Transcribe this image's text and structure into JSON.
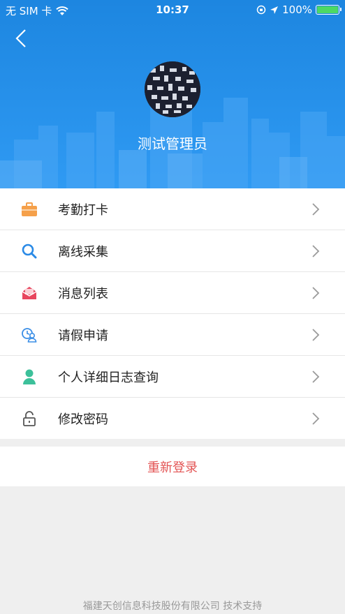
{
  "status_bar": {
    "carrier": "无 SIM 卡",
    "time": "10:37",
    "battery_text": "100%",
    "battery_level": 1.0
  },
  "profile": {
    "name": "测试管理员"
  },
  "menu": {
    "items": [
      {
        "label": "考勤打卡",
        "icon": "briefcase-icon",
        "color": "#f5a04a"
      },
      {
        "label": "离线采集",
        "icon": "search-icon",
        "color": "#2a8ae6"
      },
      {
        "label": "消息列表",
        "icon": "envelope-icon",
        "color": "#e8465e"
      },
      {
        "label": "请假申请",
        "icon": "leave-request-icon",
        "color": "#3a8ee6"
      },
      {
        "label": "个人详细日志查询",
        "icon": "person-icon",
        "color": "#3cc09a"
      },
      {
        "label": "修改密码",
        "icon": "lock-icon",
        "color": "#555555"
      }
    ]
  },
  "relogin_label": "重新登录",
  "footer_text": "福建天创信息科技股份有限公司 技术支持",
  "colors": {
    "header": "#1d86e0",
    "accent_red": "#e35454",
    "background": "#efefef"
  }
}
